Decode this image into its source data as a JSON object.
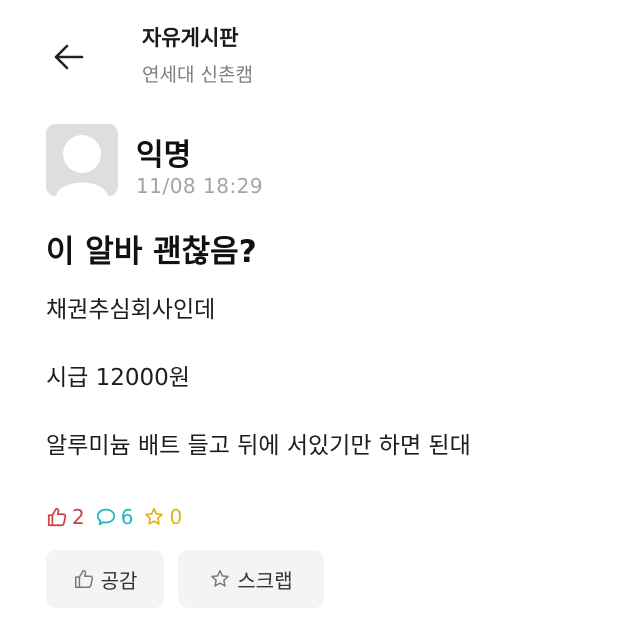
{
  "header": {
    "back_icon": "arrow-left-icon",
    "board_title": "자유게시판",
    "board_subtitle": "연세대 신촌캠"
  },
  "post": {
    "author": "익명",
    "time": "11/08 18:29",
    "title": "이 알바 괜찮음?",
    "body": [
      "채권추심회사인데",
      "시급 12000원",
      "알루미늄 배트 들고 뒤에 서있기만 하면 된대"
    ],
    "stats": {
      "likes": "2",
      "comments": "6",
      "scraps": "0"
    },
    "actions": {
      "like_label": "공감",
      "scrap_label": "스크랩"
    }
  },
  "colors": {
    "like": "#c8423d",
    "comment": "#1fb6c6",
    "scrap": "#e3b21d"
  }
}
